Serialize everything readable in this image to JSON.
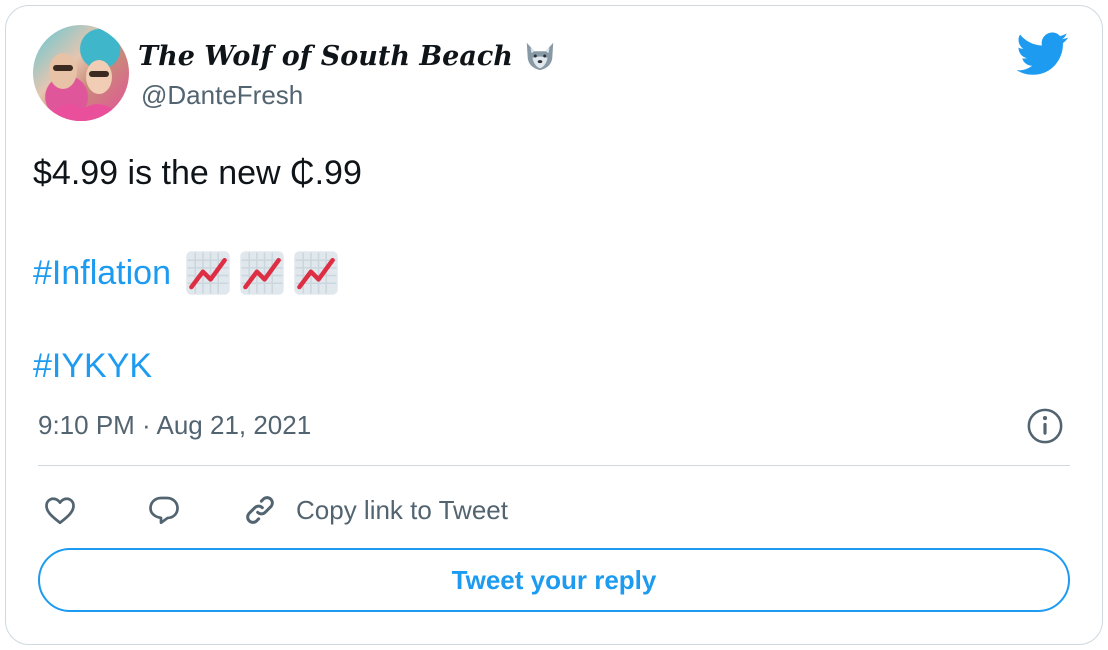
{
  "author": {
    "display_name": "The Wolf of South Beach",
    "handle": "@DanteFresh",
    "name_emoji": "wolf-icon"
  },
  "tweet": {
    "line1": "$4.99 is the new ₵.99",
    "hashtag1": "#Inflation",
    "hashtag1_emojis": [
      "chart-increasing-icon",
      "chart-increasing-icon",
      "chart-increasing-icon"
    ],
    "hashtag2": "#IYKYK",
    "timestamp": "9:10 PM · Aug 21, 2021"
  },
  "actions": {
    "like_icon": "heart-icon",
    "reply_icon": "speech-bubble-icon",
    "copy_link_icon": "link-icon",
    "copy_link_label": "Copy link to Tweet",
    "reply_button_label": "Tweet your reply"
  },
  "colors": {
    "accent": "#1d9bf0",
    "text": "#0f1419",
    "secondary_text": "#536471",
    "border": "#cfd9de"
  }
}
